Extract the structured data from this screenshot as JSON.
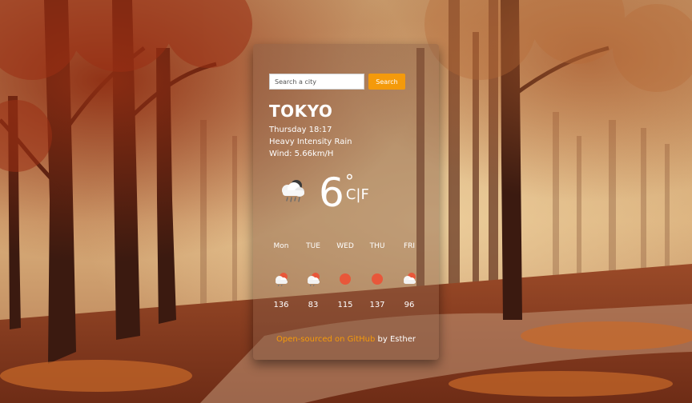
{
  "search": {
    "placeholder": "Search a city",
    "button_label": "Search"
  },
  "current": {
    "city": "TOKYO",
    "datetime": "Thursday 18:17",
    "description": "Heavy Intensity Rain",
    "wind": "Wind: 5.66km/H",
    "temperature": "6",
    "degree_symbol": "°",
    "units": "C|F",
    "icon": "cloud-rain-icon"
  },
  "forecast": [
    {
      "day": "Mon",
      "value": "136",
      "icon": "cloud-sun-icon"
    },
    {
      "day": "TUE",
      "value": "83",
      "icon": "cloud-sun-icon"
    },
    {
      "day": "WED",
      "value": "115",
      "icon": "sun-icon"
    },
    {
      "day": "THU",
      "value": "137",
      "icon": "sun-icon"
    },
    {
      "day": "FRI",
      "value": "96",
      "icon": "cloud-sun-icon"
    }
  ],
  "footer": {
    "link_text": "Open-sourced on GitHub",
    "author_text": " by Esther"
  },
  "colors": {
    "accent": "#f49a0b",
    "sun": "#e8573a",
    "card_tint": "#825a46"
  }
}
